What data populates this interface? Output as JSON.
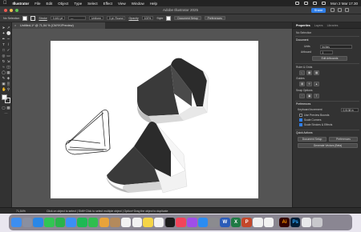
{
  "menubar": {
    "app_name": "Illustrator",
    "items": [
      "File",
      "Edit",
      "Object",
      "Type",
      "Select",
      "Effect",
      "View",
      "Window",
      "Help"
    ],
    "datetime": "Mon 2 Mar  17.30"
  },
  "window": {
    "title": "Adobe Illustrator 2025",
    "share_label": "Share"
  },
  "control_bar": {
    "selection_label": "No Selection",
    "stroke_label": "Stroke",
    "stroke_value": "0,441 pt",
    "profile_label": "Uniform",
    "brush_label": "3 pt. Round",
    "opacity_label": "Opacity",
    "opacity_value": "100%",
    "style_label": "Style",
    "doc_setup_label": "Document Setup",
    "preferences_label": "Preferences"
  },
  "document_tab": {
    "title": "Untitled-1* @ 71,54 % (CMYK/Preview)"
  },
  "panel": {
    "tabs": [
      "Properties",
      "Layers",
      "Libraries"
    ],
    "no_selection": "No Selection",
    "document_heading": "Document",
    "units_label": "Units",
    "units_value": "Inches",
    "artboard_label": "Artboard",
    "artboard_value": "1",
    "edit_artboards_label": "Edit Artboards",
    "rulers_label": "Ruler & Grids",
    "guides_label": "Guides",
    "snap_label": "Snap Options",
    "preferences_heading": "Preferences",
    "keyboard_increment_label": "Keyboard Increment",
    "keyboard_increment_value": "0,0138 in",
    "use_preview_bounds": "Use Preview Bounds",
    "scale_corners": "Scale Corners",
    "scale_strokes": "Scale Strokes & Effects",
    "quick_actions_heading": "Quick Actions",
    "doc_setup_btn": "Document Setup",
    "preferences_btn": "Preferences",
    "generate_btn": "Generate Vectors (Beta)"
  },
  "statusbar": {
    "zoom": "71,54%",
    "tip": "Click on object to select  |  Shift+Click to select multiple object  |  Option+Drag the object to duplicate"
  },
  "dock": {
    "apps": [
      {
        "name": "finder",
        "color": "#3d8ef0",
        "glyph": ""
      },
      {
        "name": "launchpad",
        "color": "#8a8fa0",
        "glyph": ""
      },
      {
        "name": "safari",
        "color": "#2a87e6",
        "glyph": ""
      },
      {
        "name": "messages",
        "color": "#31c553",
        "glyph": ""
      },
      {
        "name": "whatsapp",
        "color": "#29b34a",
        "glyph": ""
      },
      {
        "name": "mail",
        "color": "#3b8ff5",
        "glyph": ""
      },
      {
        "name": "spotify",
        "color": "#1db954",
        "glyph": ""
      },
      {
        "name": "facetime",
        "color": "#2fbe4e",
        "glyph": ""
      },
      {
        "name": "photos",
        "color": "#e8a33a",
        "glyph": ""
      },
      {
        "name": "contacts",
        "color": "#b48a5c",
        "glyph": ""
      },
      {
        "name": "calendar",
        "color": "#f2f2f2",
        "glyph": ""
      },
      {
        "name": "reminders",
        "color": "#f2f2f2",
        "glyph": ""
      },
      {
        "name": "notes",
        "color": "#f5d547",
        "glyph": ""
      },
      {
        "name": "freeform",
        "color": "#f2f2f2",
        "glyph": ""
      },
      {
        "name": "tv",
        "color": "#1c1c1c",
        "glyph": ""
      },
      {
        "name": "music",
        "color": "#f2445a",
        "glyph": ""
      },
      {
        "name": "podcasts",
        "color": "#a04ee8",
        "glyph": ""
      },
      {
        "name": "app-store",
        "color": "#2b8cf2",
        "glyph": ""
      },
      {
        "name": "system-settings",
        "color": "#8b8b8f",
        "glyph": ""
      },
      {
        "name": "word",
        "color": "#2b5cb8",
        "glyph": "W"
      },
      {
        "name": "excel",
        "color": "#1f7a45",
        "glyph": "X"
      },
      {
        "name": "powerpoint",
        "color": "#c4472a",
        "glyph": "P"
      },
      {
        "name": "browser",
        "color": "#f0f0f0",
        "glyph": ""
      },
      {
        "name": "chrome",
        "color": "#f2f2f2",
        "glyph": ""
      }
    ],
    "recent_apps": [
      {
        "name": "illustrator",
        "color": "#330000",
        "glyph": "Ai"
      },
      {
        "name": "photoshop",
        "color": "#001e36",
        "glyph": "Ps"
      },
      {
        "name": "preview",
        "color": "#e8e8ea",
        "glyph": ""
      },
      {
        "name": "trash",
        "color": "#c8c8cc",
        "glyph": ""
      }
    ]
  }
}
